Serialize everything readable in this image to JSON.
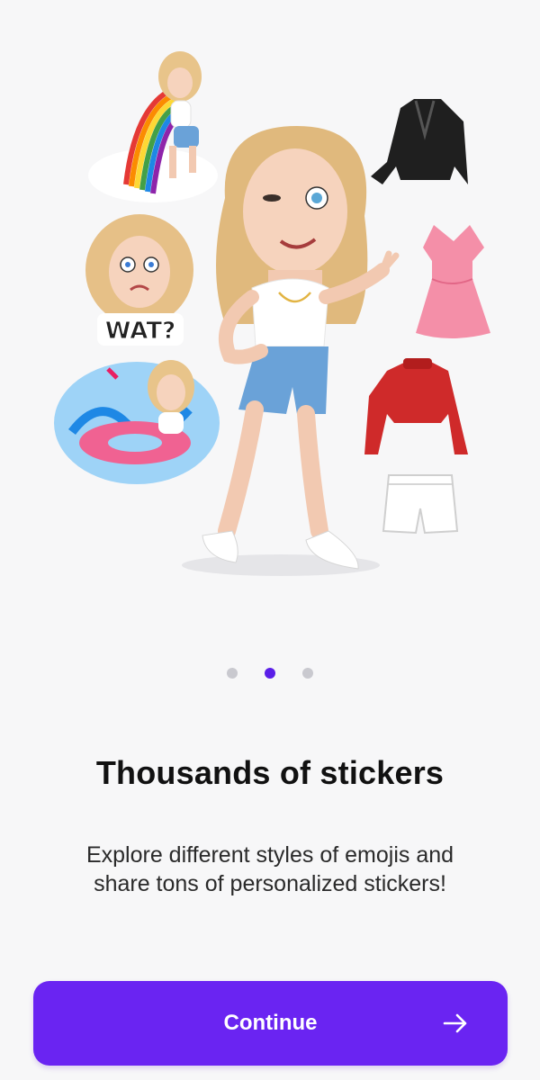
{
  "illustration": {
    "wat_label": "WAT?"
  },
  "pager": {
    "count": 3,
    "active_index": 1
  },
  "onboarding": {
    "title": "Thousands of stickers",
    "description": "Explore different styles of emojis and share tons of personalized stickers!"
  },
  "actions": {
    "continue_label": "Continue",
    "continue_icon": "arrow-right-icon"
  },
  "colors": {
    "accent": "#6a24f2",
    "dot_active": "#5b1fe8",
    "dot_inactive": "#c9c9cf",
    "background": "#f7f7f8"
  }
}
